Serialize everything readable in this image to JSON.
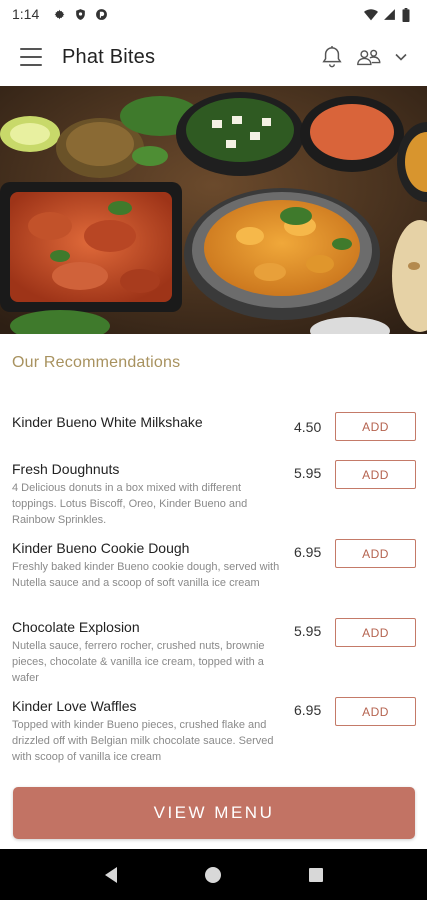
{
  "status_bar": {
    "time": "1:14",
    "left_icons": [
      "gear-icon",
      "shield-icon",
      "data-saver-icon"
    ],
    "right_icons": [
      "wifi-icon",
      "cell-signal-icon",
      "battery-icon"
    ]
  },
  "app_bar": {
    "title": "Phat Bites",
    "menu_icon": "hamburger-icon",
    "notification_icon": "bell-icon",
    "user_icon": "users-icon",
    "dropdown_icon": "chevron-down-icon"
  },
  "hero": {
    "description_icon": "food-banner-image"
  },
  "recommendations": {
    "title": "Our Recommendations",
    "items": [
      {
        "name": "Kinder Bueno White Milkshake",
        "description": "",
        "price": "4.50",
        "button_label": "ADD"
      },
      {
        "name": "Fresh Doughnuts",
        "description": "4 Delicious donuts in a box mixed with different toppings. Lotus Biscoff, Oreo, Kinder Bueno and Rainbow Sprinkles.",
        "price": "5.95",
        "button_label": "ADD"
      },
      {
        "name": "Kinder Bueno Cookie Dough",
        "description": "Freshly baked kinder Bueno cookie dough, served with Nutella sauce and a scoop of soft vanilla ice cream",
        "price": "6.95",
        "button_label": "ADD"
      },
      {
        "name": "Chocolate Explosion",
        "description": "Nutella sauce, ferrero rocher, crushed nuts, brownie pieces, chocolate & vanilla ice cream, topped with a wafer",
        "price": "5.95",
        "button_label": "ADD"
      },
      {
        "name": "Kinder Love Waffles",
        "description": "Topped with kinder Bueno pieces, crushed flake and drizzled off with Belgian milk chocolate sauce. Served with scoop of vanilla ice cream",
        "price": "6.95",
        "button_label": "ADD"
      }
    ]
  },
  "view_menu": {
    "label": "VIEW MENU"
  },
  "nav_bar": {
    "icons": [
      "back-icon",
      "home-icon",
      "recents-icon"
    ]
  },
  "colors": {
    "accent": "#c27364",
    "section_title": "#a8925f",
    "add_border": "#c47a68"
  }
}
